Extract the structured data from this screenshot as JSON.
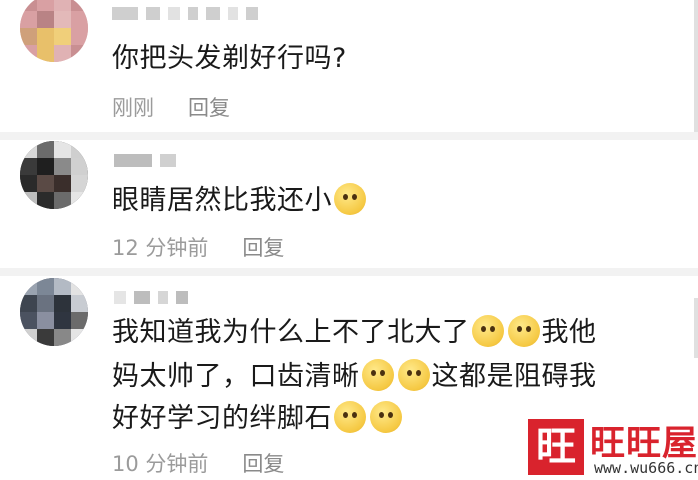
{
  "comments": [
    {
      "text": "你把头发剃好行吗?",
      "time": "刚刚",
      "reply": "回复",
      "emojis": []
    },
    {
      "text": "眼睛居然比我还小",
      "time": "12 分钟前",
      "reply": "回复",
      "emojis": [
        "smile-emoji"
      ]
    },
    {
      "line1": "我知道我为什么上不了北大了",
      "line1b": "我他",
      "line2": "妈太帅了，口齿清晰",
      "line2b": "这都是阻碍我",
      "line3": "好好学习的绊脚石",
      "time": "10 分钟前",
      "reply": "回复",
      "emojis": [
        "pleading-emoji",
        "pleading-emoji"
      ]
    }
  ],
  "watermark": {
    "seal": "旺",
    "name": "旺旺屋",
    "url": "www.wu666.cn"
  },
  "colors": {
    "watermark": "#d9232d",
    "meta_text": "#9b9b9b",
    "separator": "#f2f2f2"
  }
}
